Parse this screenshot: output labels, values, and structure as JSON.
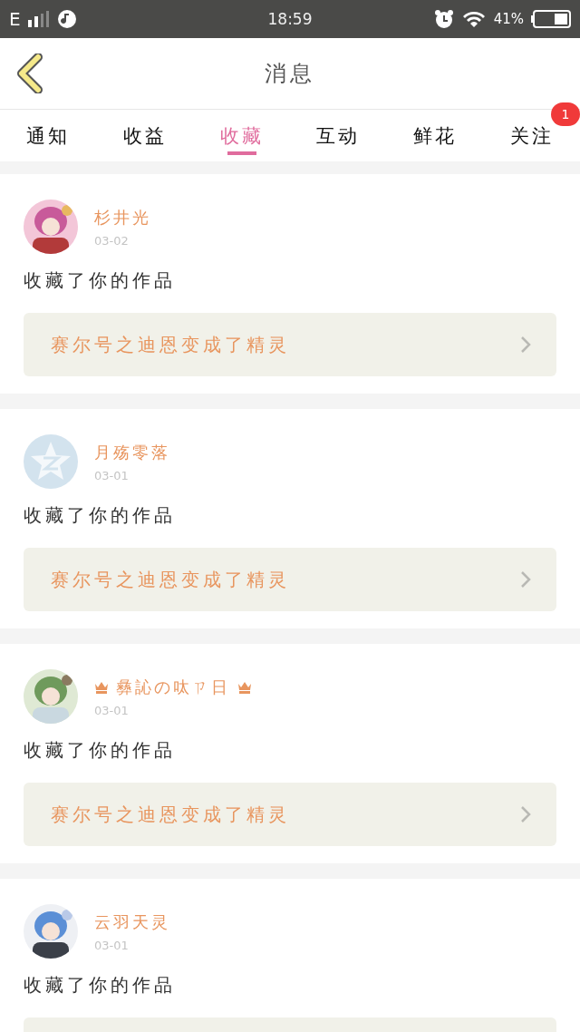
{
  "status_bar": {
    "network": "E",
    "time": "18:59",
    "battery": "41%"
  },
  "header": {
    "title": "消息"
  },
  "tabs": [
    {
      "label": "通知",
      "selected": false
    },
    {
      "label": "收益",
      "selected": false
    },
    {
      "label": "收藏",
      "selected": true
    },
    {
      "label": "互动",
      "selected": false
    },
    {
      "label": "鲜花",
      "selected": false
    },
    {
      "label": "关注",
      "selected": false,
      "badge": "1"
    }
  ],
  "messages": [
    {
      "name": "杉井光",
      "crowned": false,
      "date": "03-02",
      "text": "收藏了你的作品",
      "work": "赛尔号之迪恩变成了精灵"
    },
    {
      "avatar": {
        "kind": "default"
      },
      "name": "月殇零落",
      "crowned": false,
      "date": "03-01",
      "text": "收藏了你的作品",
      "work": "赛尔号之迪恩变成了精灵"
    },
    {
      "name": "彝訫の呔ㄗ日",
      "crowned": true,
      "date": "03-01",
      "text": "收藏了你的作品",
      "work": "赛尔号之迪恩变成了精灵"
    },
    {
      "name": "云羽天灵",
      "crowned": false,
      "date": "03-01",
      "text": "收藏了你的作品"
    }
  ]
}
